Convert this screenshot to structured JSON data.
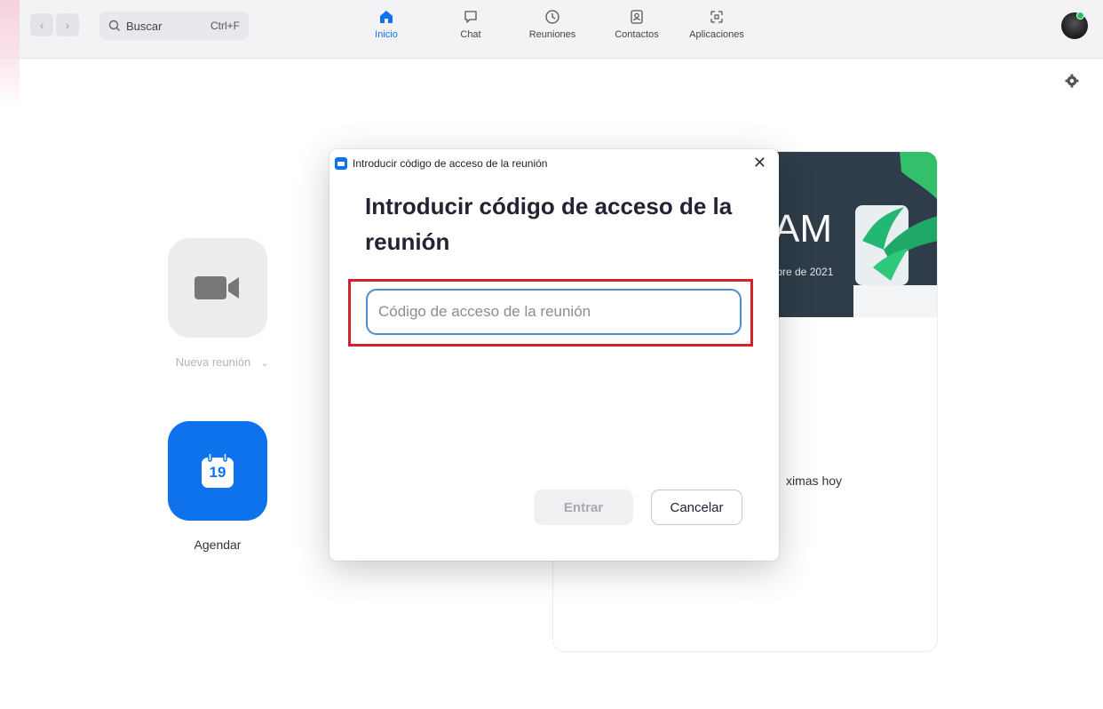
{
  "topbar": {
    "search_label": "Buscar",
    "search_shortcut": "Ctrl+F",
    "tabs": [
      {
        "label": "Inicio",
        "icon": "home-icon"
      },
      {
        "label": "Chat",
        "icon": "chat-icon"
      },
      {
        "label": "Reuniones",
        "icon": "clock-icon"
      },
      {
        "label": "Contactos",
        "icon": "contacts-icon"
      },
      {
        "label": "Aplicaciones",
        "icon": "apps-icon"
      }
    ],
    "active_tab": "Inicio",
    "accent_color": "#0e72ed",
    "presence_color": "#20c55e"
  },
  "home": {
    "new_meeting_label": "Nueva reunión",
    "schedule_label": "Agendar",
    "calendar_day": "19"
  },
  "card": {
    "time_partial": "AM",
    "date_partial": "ıbre de 2021",
    "upcoming_partial": "ximas hoy"
  },
  "dialog": {
    "window_title": "Introducir código de acceso de la reunión",
    "heading": "Introducir código de acceso de la reunión",
    "input_value": "",
    "input_placeholder": "Código de acceso de la reunión",
    "join_label": "Entrar",
    "cancel_label": "Cancelar",
    "close_glyph": "✕"
  }
}
